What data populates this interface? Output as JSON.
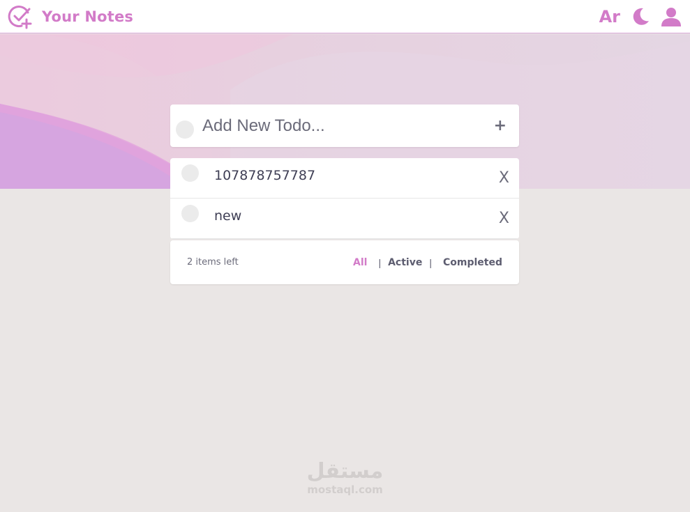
{
  "header": {
    "title": "Your Notes",
    "logo_icon": "check-circle-plus-icon",
    "lang_label": "Ar",
    "theme_icon": "moon-icon",
    "user_icon": "user-icon",
    "accent_color": "#d27bc8"
  },
  "new_todo": {
    "placeholder": "Add New Todo...",
    "add_label": "+"
  },
  "todos": [
    {
      "text": "107878757787",
      "completed": false,
      "delete_label": "X"
    },
    {
      "text": "new",
      "completed": false,
      "delete_label": "X"
    }
  ],
  "footer": {
    "items_left": "2 items left",
    "filters": [
      "All",
      "Active",
      "Completed"
    ],
    "active_filter": "All",
    "separator": "|"
  },
  "watermark": {
    "arabic": "مستقل",
    "latin": "mostaql.com"
  }
}
